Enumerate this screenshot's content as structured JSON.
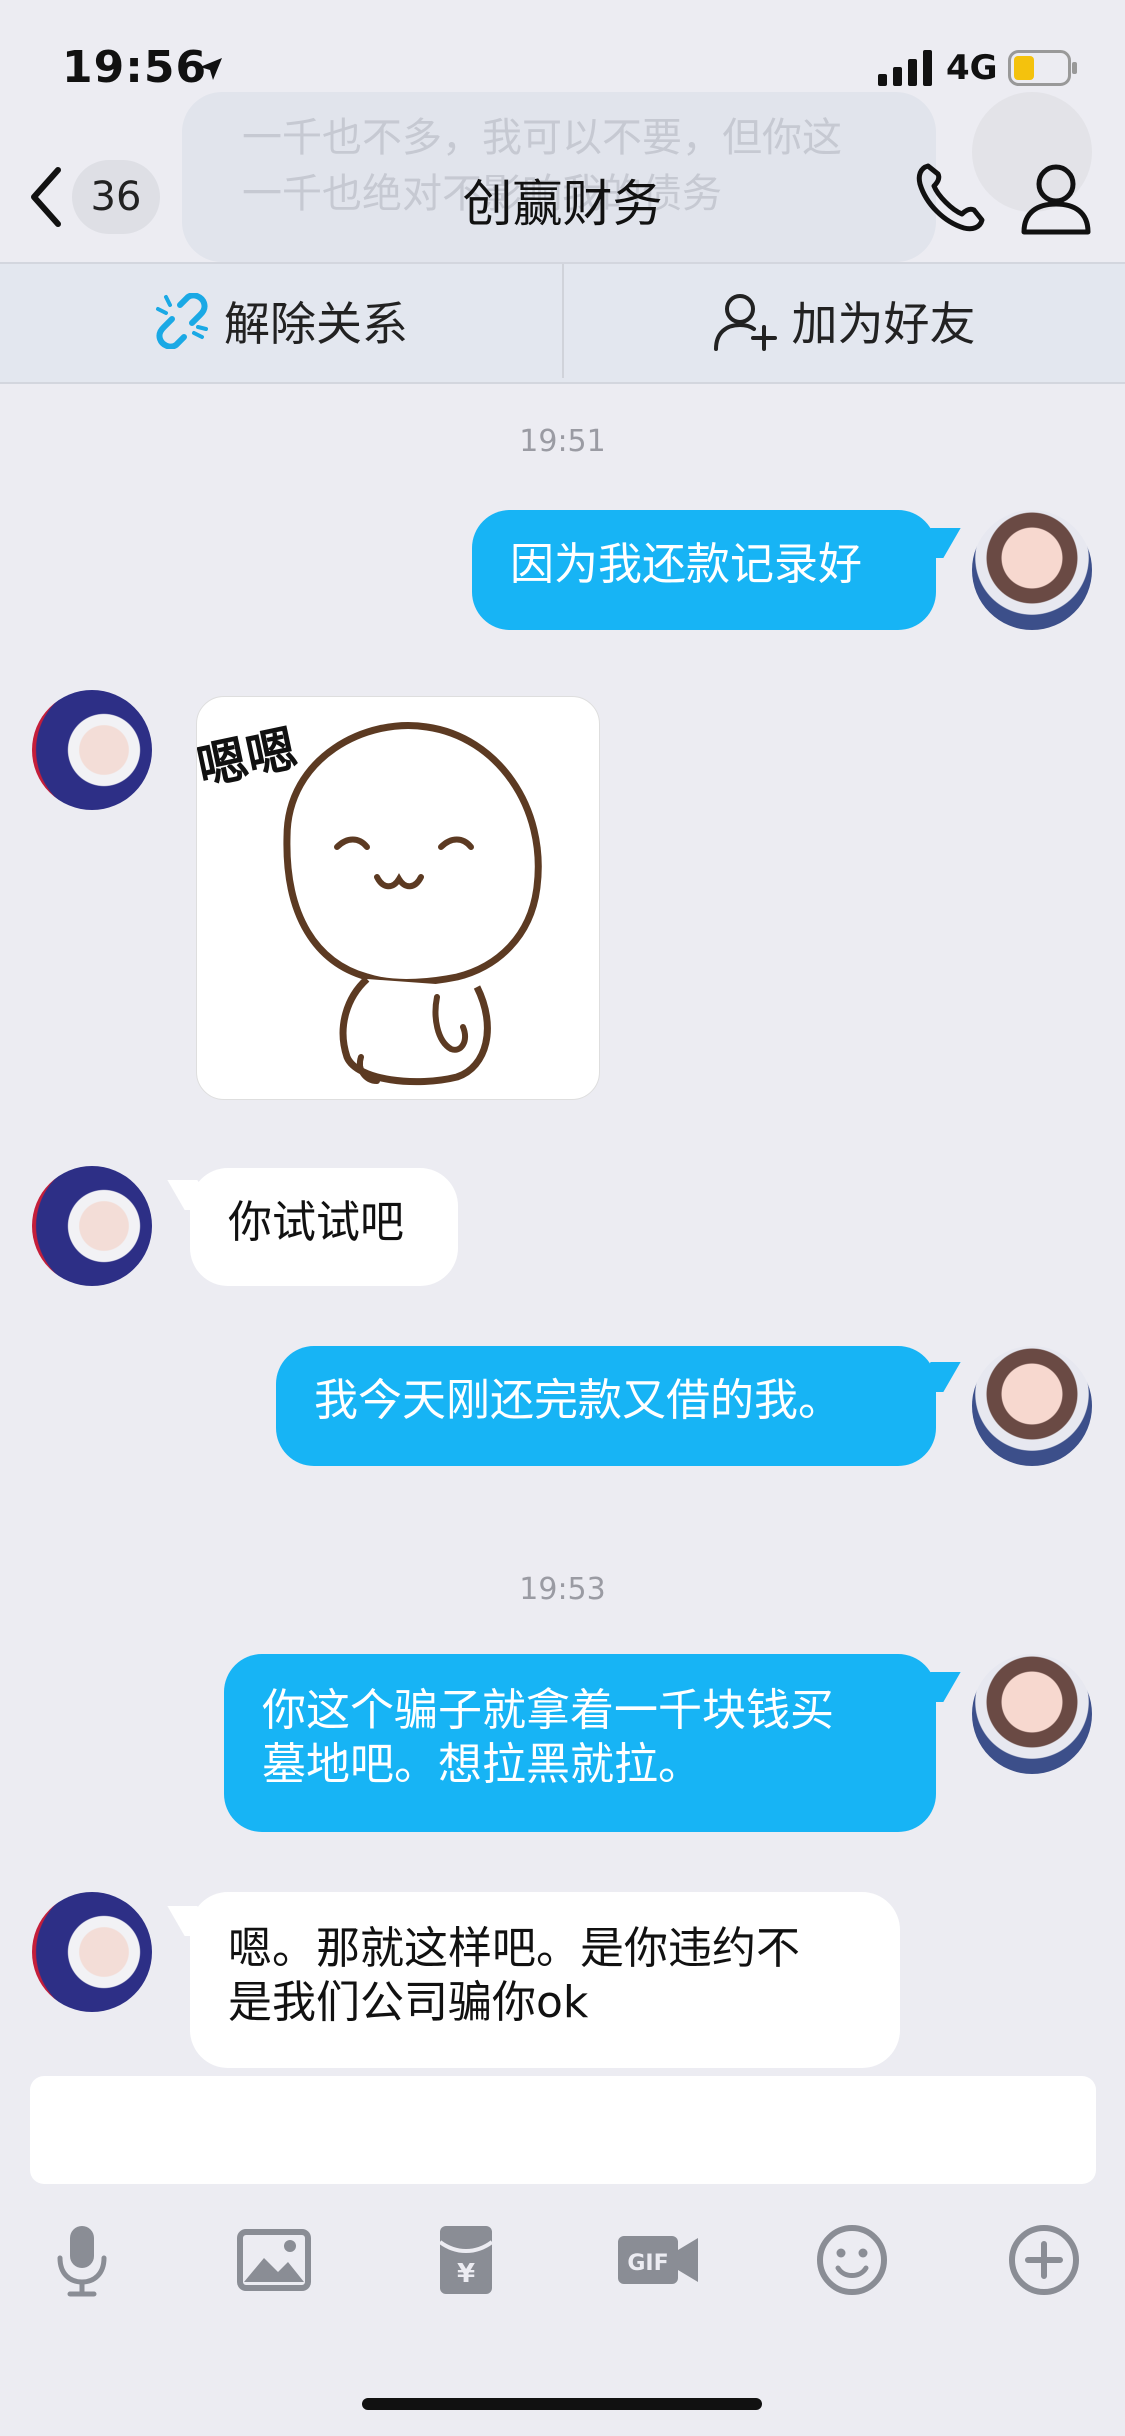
{
  "status_bar": {
    "time": "19:56",
    "network": "4G"
  },
  "ghost_banner": {
    "text": "一千也不多，我可以不要，但你这一千也绝对不影响我的债务"
  },
  "nav": {
    "unread_count": "36",
    "title": "创赢财务"
  },
  "actions": {
    "unlink_label": "解除关系",
    "add_friend_label": "加为好友"
  },
  "messages": {
    "ts1": "19:51",
    "m1": "因为我还款记录好",
    "sticker_text": "嗯嗯",
    "m2": "你试试吧",
    "m3": "我今天刚还完款又借的我。",
    "ts2": "19:53",
    "m4_line1": "你这个骗子就拿着一千块钱买",
    "m4_line2": "墓地吧。想拉黑就拉。",
    "m5_line1": "嗯。那就这样吧。是你违约不",
    "m5_line2": "是我们公司骗你ok"
  },
  "toolbar": {
    "icons": [
      "microphone-icon",
      "image-icon",
      "red-packet-icon",
      "gif-icon",
      "emoji-icon",
      "plus-icon"
    ]
  },
  "colors": {
    "outgoing_bubble": "#17b4f5",
    "incoming_bubble": "#ffffff",
    "background": "#ececf2",
    "icon_gray": "#8a8d95"
  }
}
